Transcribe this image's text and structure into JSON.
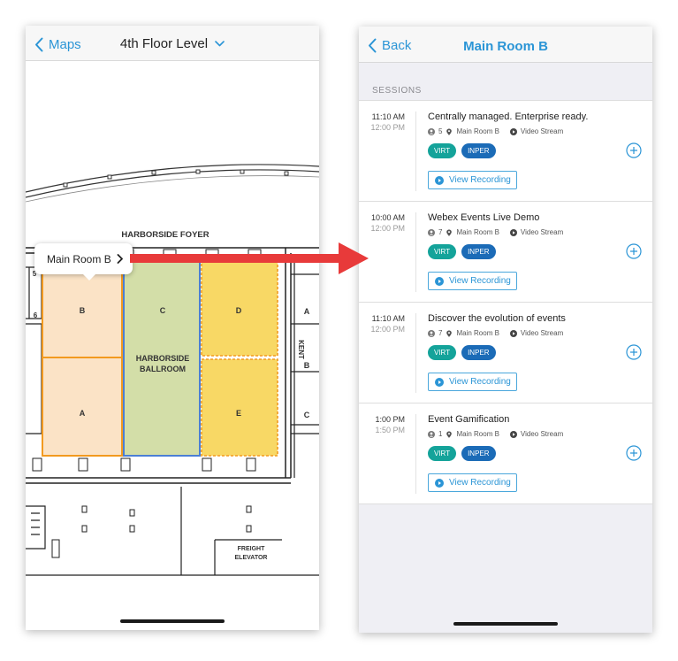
{
  "left_screen": {
    "back_label": "Maps",
    "floor_title": "4th Floor Level",
    "map": {
      "foyer_label": "HARBORSIDE FOYER",
      "ballroom_label_1": "HARBORSIDE",
      "ballroom_label_2": "BALLROOM",
      "rooms": [
        "A",
        "B",
        "C",
        "D",
        "E"
      ],
      "side_rooms": [
        "A",
        "B",
        "C"
      ],
      "side_numbers": [
        "5",
        "6"
      ],
      "kent_label": "KENT",
      "freight_label_1": "FREIGHT",
      "freight_label_2": "ELEVATOR",
      "colors": {
        "room_orange_fill": "#fbe3c6",
        "room_orange_border": "#f29a1f",
        "room_green_fill": "#d3dea8",
        "room_blue_border": "#4a7fd4",
        "room_yellow_fill": "#f8d865"
      }
    },
    "callout_label": "Main Room B"
  },
  "right_screen": {
    "back_label": "Back",
    "title": "Main Room B",
    "section_header": "SESSIONS",
    "sessions": [
      {
        "start": "11:10 AM",
        "end": "12:00 PM",
        "title": "Centrally managed. Enterprise ready.",
        "attendees": "5",
        "room": "Main Room B",
        "stream": "Video Stream",
        "tags": [
          "VIRT",
          "INPER"
        ],
        "recording_label": "View Recording"
      },
      {
        "start": "10:00 AM",
        "end": "12:00 PM",
        "title": "Webex Events Live Demo",
        "attendees": "7",
        "room": "Main Room B",
        "stream": "Video Stream",
        "tags": [
          "VIRT",
          "INPER"
        ],
        "recording_label": "View Recording"
      },
      {
        "start": "11:10 AM",
        "end": "12:00 PM",
        "title": "Discover the evolution of events",
        "attendees": "7",
        "room": "Main Room B",
        "stream": "Video Stream",
        "tags": [
          "VIRT",
          "INPER"
        ],
        "recording_label": "View Recording"
      },
      {
        "start": "1:00 PM",
        "end": "1:50 PM",
        "title": "Event Gamification",
        "attendees": "1",
        "room": "Main Room B",
        "stream": "Video Stream",
        "tags": [
          "VIRT",
          "INPER"
        ],
        "recording_label": "View Recording"
      }
    ]
  },
  "colors": {
    "accent": "#2b95d6",
    "tag_virt": "#14a39a",
    "tag_inper": "#1b6bb7",
    "arrow": "#e83a3a"
  }
}
